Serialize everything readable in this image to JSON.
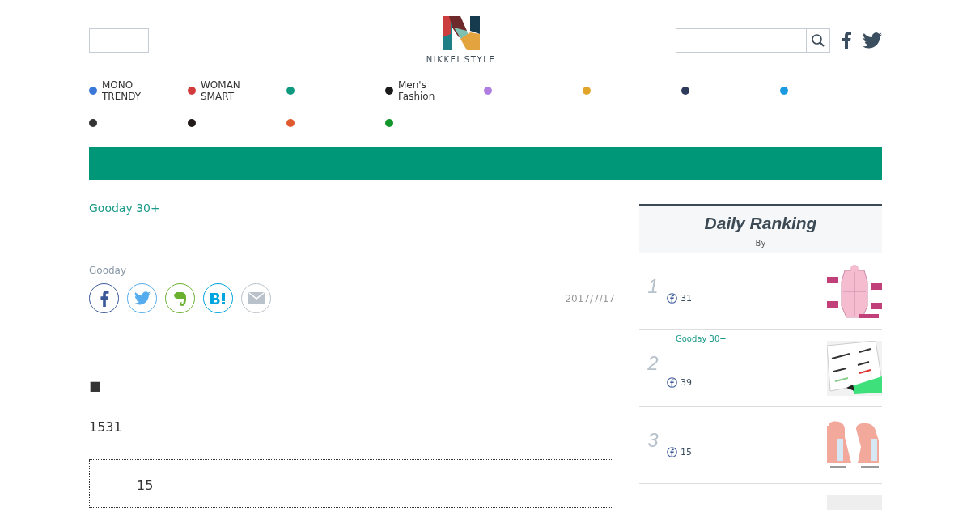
{
  "header": {
    "logo": {
      "text": "NIKKEI STYLE"
    }
  },
  "nav": [
    {
      "label": "MONO TRENDY",
      "color": "#3a78d8"
    },
    {
      "label": "WOMAN SMART",
      "color": "#d23b3b"
    },
    {
      "color": "#0f9a80"
    },
    {
      "label": "Men's Fashion",
      "color": "#1a1a1a"
    },
    {
      "color": "#b07ee0"
    },
    {
      "color": "#e0a52a"
    },
    {
      "color": "#2e3a5c"
    },
    {
      "color": "#1a9ae0"
    },
    {
      "color": "#333333"
    },
    {
      "color": "#221a18"
    },
    {
      "color": "#e05a30"
    },
    {
      "color": "#12962a"
    }
  ],
  "article": {
    "category": "Gooday 30+",
    "author": "Gooday",
    "date": "2017/7/17",
    "share": [
      {
        "kind": "facebook"
      },
      {
        "kind": "twitter"
      },
      {
        "kind": "evernote"
      },
      {
        "kind": "hatena"
      },
      {
        "kind": "mail"
      }
    ],
    "bullet": "■",
    "paragraph": "1531",
    "box_text": "15"
  },
  "ranking": {
    "title": "Daily Ranking",
    "subtitle": "- By  -",
    "items": [
      {
        "rank": "1",
        "likes": "31",
        "kind": "body"
      },
      {
        "rank": "2",
        "tag": "Gooday 30+",
        "likes": "39",
        "kind": "note"
      },
      {
        "rank": "3",
        "likes": "15",
        "kind": "neck"
      },
      {
        "kind": "blank"
      }
    ]
  }
}
